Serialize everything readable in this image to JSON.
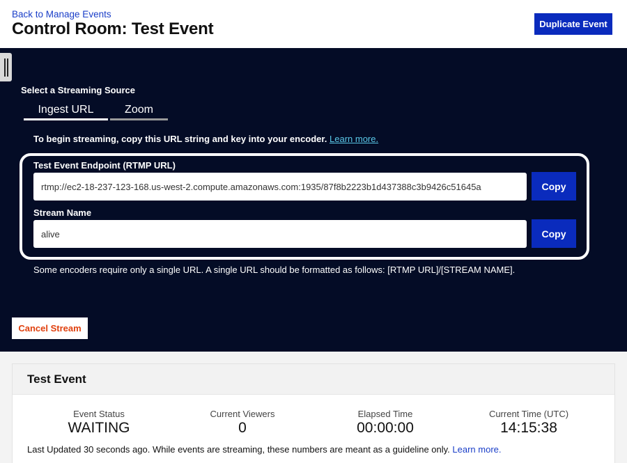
{
  "header": {
    "back_link": "Back to Manage Events",
    "title": "Control Room: Test Event",
    "duplicate_label": "Duplicate Event"
  },
  "control": {
    "source_label": "Select a Streaming Source",
    "tabs": [
      {
        "label": "Ingest URL",
        "active": true
      },
      {
        "label": "Zoom",
        "active": false
      }
    ],
    "instructions": "To begin streaming, copy this URL string and key into your encoder.",
    "learn_more": "Learn more.",
    "endpoint_label": "Test Event Endpoint (RTMP URL)",
    "endpoint_value": "rtmp://ec2-18-237-123-168.us-west-2.compute.amazonaws.com:1935/87f8b2223b1d437388c3b9426c51645a",
    "stream_name_label": "Stream Name",
    "stream_name_value": "alive",
    "copy_label": "Copy",
    "note": "Some encoders require only a single URL. A single URL should be formatted as follows: [RTMP URL]/[STREAM NAME].",
    "cancel_label": "Cancel Stream"
  },
  "event": {
    "title": "Test Event",
    "stats": [
      {
        "label": "Event Status",
        "value": "WAITING"
      },
      {
        "label": "Current Viewers",
        "value": "0"
      },
      {
        "label": "Elapsed Time",
        "value": "00:00:00"
      },
      {
        "label": "Current Time (UTC)",
        "value": "14:15:38"
      }
    ],
    "updated_text": "Last Updated 30 seconds ago. While events are streaming, these numbers are meant as a guideline only.",
    "learn_more": "Learn more."
  },
  "colors": {
    "primary": "#0a2bbd",
    "control_bg": "#040c26",
    "cancel_text": "#e0400e",
    "learn_more_dark": "#5ac8e8"
  }
}
